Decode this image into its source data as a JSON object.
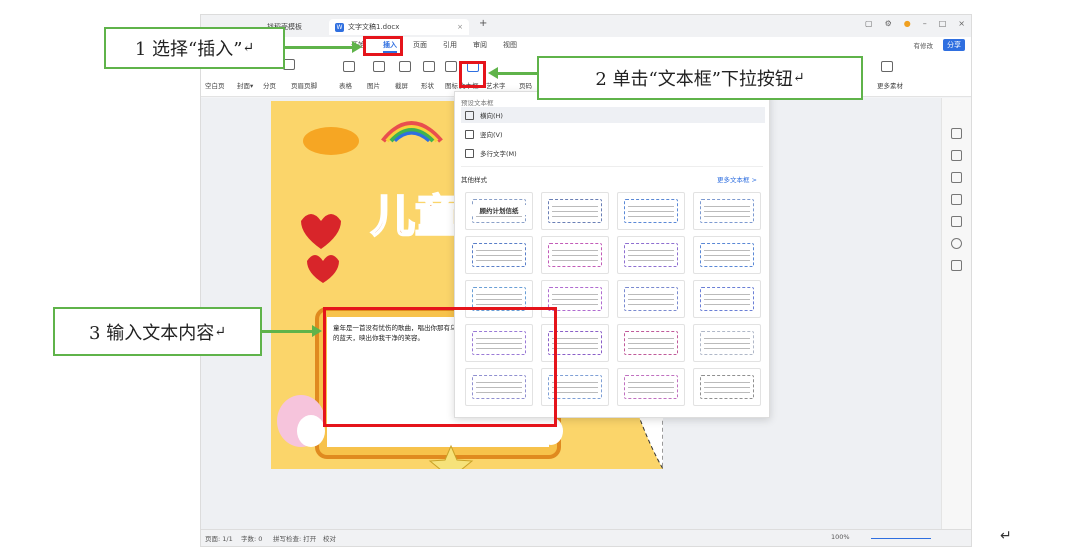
{
  "titlebar": {
    "tab_prev": "找稻壳模板",
    "tab_doc": "文字文稿1.docx",
    "new_tab": "+"
  },
  "menubar": {
    "items": [
      "开始",
      "插入",
      "页面",
      "引用",
      "审阅",
      "视图"
    ],
    "active": "插入",
    "edit_label": "有修改",
    "share_label": "分享"
  },
  "ribbon": {
    "row2_left": [
      "空白页",
      "分页",
      "页眉页脚"
    ],
    "row2_mid": [
      "表格",
      "图片",
      "截屏",
      "形状",
      "图标"
    ],
    "textbox_label": "文本框",
    "arttext_label": "艺术字",
    "page_label": "页码",
    "more_label": "更多素材"
  },
  "dropdown": {
    "preset_header": "预设文本框",
    "presets": [
      "横向(H)",
      "竖向(V)",
      "多行文字(M)"
    ],
    "other_header": "其他样式",
    "more_link": "更多文本框 >",
    "template_title": "顾约计划信纸"
  },
  "document": {
    "textbox_text": "童年是一首没有忧伤的歌曲，唱出你那有乌云的蓝天，映出你我干净的笑容。"
  },
  "status": {
    "page": "页面: 1/1",
    "words": "字数: 0",
    "spell": "拼写检查: 打开",
    "proof": "校对",
    "zoom": "100%"
  },
  "callouts": {
    "step1": "1 选择“插入”",
    "step2": "2 单击“文本框”下拉按钮",
    "step3": "3 输入文本内容"
  },
  "return_mark": "↵",
  "colors": {
    "accent": "#2f6fe0",
    "callout_border": "#5fb34a",
    "highlight": "#e5141b",
    "page": "#fbd56a"
  }
}
